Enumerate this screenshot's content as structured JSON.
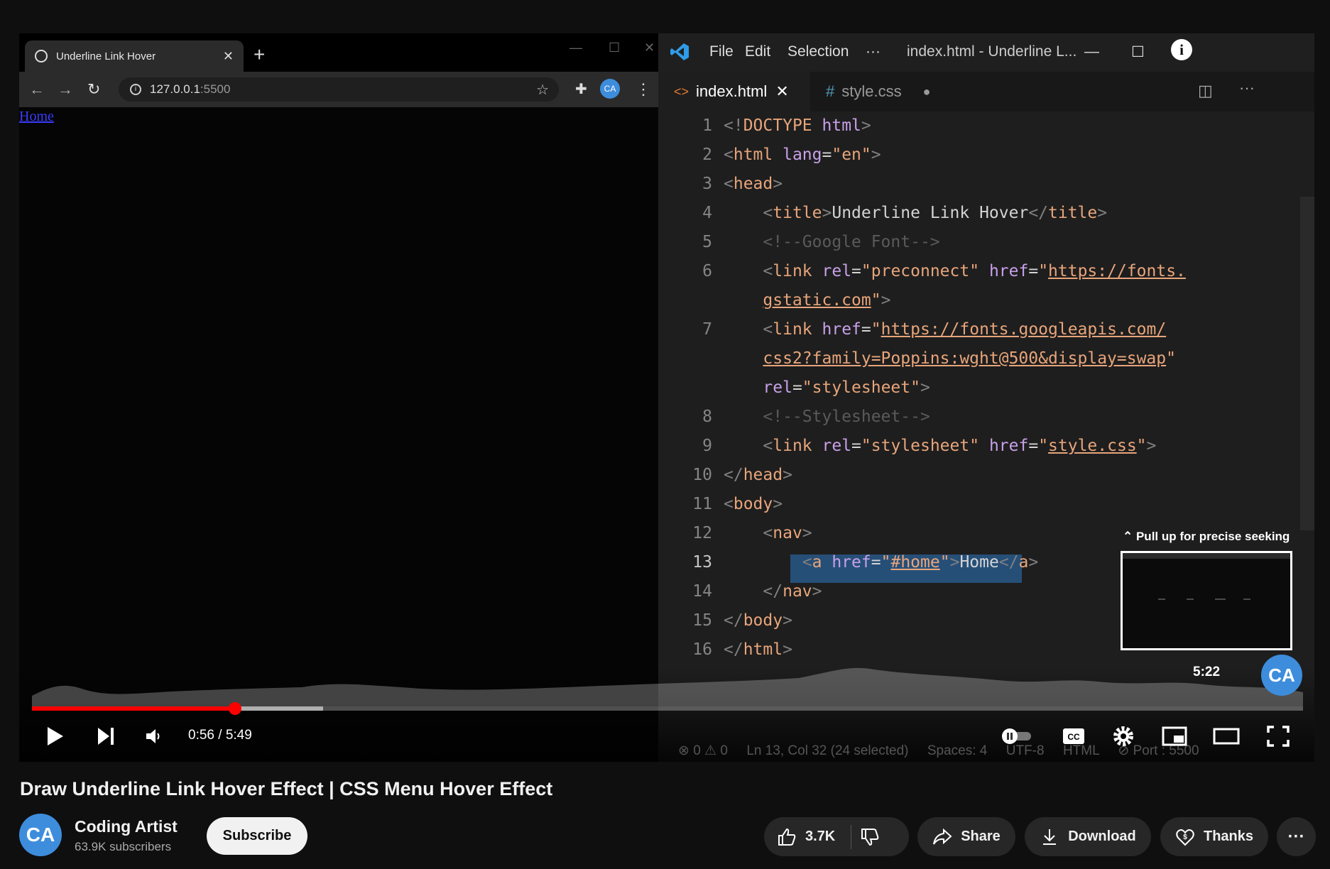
{
  "browser": {
    "tab_title": "Underline Link Hover",
    "url_host": "127.0.0.1",
    "url_port": ":5500",
    "page_link": "Home"
  },
  "vscode": {
    "menu": [
      "File",
      "Edit",
      "Selection",
      "···"
    ],
    "window_title": "index.html - Underline L...",
    "tabs": [
      "index.html",
      "style.css"
    ],
    "status": "⊗ 0 ⚠ 0     Ln 13, Col 32 (24 selected)     Spaces: 4     UTF-8     HTML     ⊘ Port : 5500",
    "line_numbers": [
      "1",
      "2",
      "3",
      "4",
      "5",
      "6",
      "7",
      "8",
      "9",
      "10",
      "11",
      "12",
      "13",
      "14",
      "15",
      "16"
    ]
  },
  "player": {
    "seek_hint": "⌃ Pull up for precise seeking",
    "preview_time": "5:22",
    "current_time": "0:56",
    "duration": "5:49",
    "time_display": "0:56 / 5:49",
    "progress_fraction": 0.16
  },
  "video": {
    "title": "Draw Underline Link Hover Effect | CSS Menu Hover Effect",
    "channel": "Coding Artist",
    "subscribers": "63.9K subscribers",
    "subscribe_label": "Subscribe",
    "likes": "3.7K",
    "share_label": "Share",
    "download_label": "Download",
    "thanks_label": "Thanks",
    "avatar_text": "CA"
  },
  "colors": {
    "accent": "#ff0000",
    "brand": "#3d8ddc"
  }
}
